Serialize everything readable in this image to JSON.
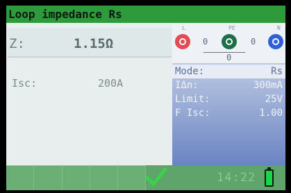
{
  "title": "Loop impedance Rs",
  "result": {
    "z_label": "Z:",
    "z_value": "1.15Ω",
    "isc_label": "Isc:",
    "isc_value": "200A"
  },
  "terminals": {
    "L": {
      "label": "L",
      "color": "#e24a55"
    },
    "PE": {
      "label": "PE",
      "color": "#1e6e4a"
    },
    "N": {
      "label": "N",
      "color": "#2f5fd7"
    },
    "l_pe_value": "0",
    "pe_n_value": "0",
    "l_n_value": "0"
  },
  "params": [
    {
      "label": "Mode:",
      "value": "Rs"
    },
    {
      "label": "IΔn:",
      "value": "300mA"
    },
    {
      "label": "Limit:",
      "value": "25V"
    },
    {
      "label": "F Isc:",
      "value": "1.00"
    }
  ],
  "status": {
    "time": "14:22",
    "battery_level": 1.0,
    "pass_icon": "check-icon"
  }
}
